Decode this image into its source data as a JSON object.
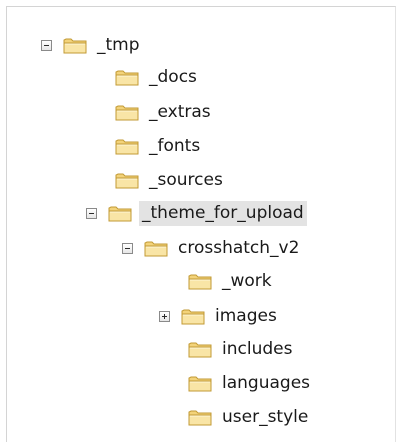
{
  "tree": {
    "items": [
      {
        "label": "_tmp",
        "expander": "expanded"
      },
      {
        "label": "_docs",
        "expander": "none"
      },
      {
        "label": "_extras",
        "expander": "none"
      },
      {
        "label": "_fonts",
        "expander": "none"
      },
      {
        "label": "_sources",
        "expander": "none"
      },
      {
        "label": "_theme_for_upload",
        "expander": "expanded",
        "selected": true
      },
      {
        "label": "crosshatch_v2",
        "expander": "expanded"
      },
      {
        "label": "_work",
        "expander": "none"
      },
      {
        "label": "images",
        "expander": "collapsed"
      },
      {
        "label": "includes",
        "expander": "none"
      },
      {
        "label": "languages",
        "expander": "none"
      },
      {
        "label": "user_style",
        "expander": "none"
      }
    ]
  },
  "colors": {
    "folder_body": "#f6de93",
    "folder_outline": "#c8a13f",
    "selection_bg": "#e3e3e3"
  },
  "icons": {
    "folder": "folder-icon",
    "expanded": "minus-box-icon",
    "collapsed": "plus-box-icon"
  }
}
